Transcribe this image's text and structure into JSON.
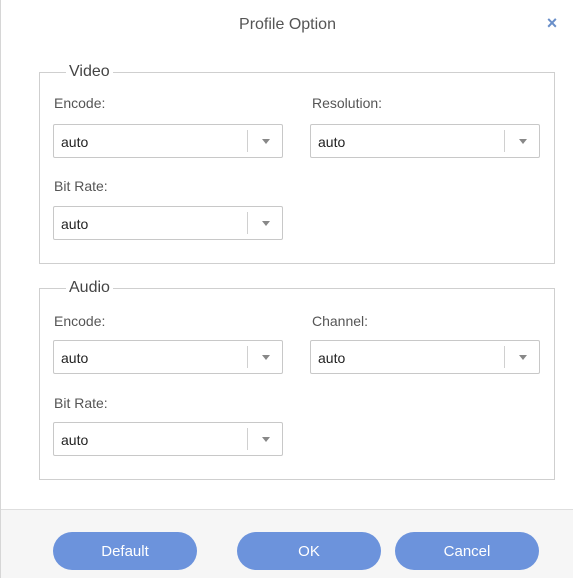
{
  "dialog": {
    "title": "Profile Option",
    "close_glyph": "×"
  },
  "video": {
    "legend": "Video",
    "encode_label": "Encode:",
    "encode_value": "auto",
    "resolution_label": "Resolution:",
    "resolution_value": "auto",
    "bitrate_label": "Bit Rate:",
    "bitrate_value": "auto"
  },
  "audio": {
    "legend": "Audio",
    "encode_label": "Encode:",
    "encode_value": "auto",
    "channel_label": "Channel:",
    "channel_value": "auto",
    "bitrate_label": "Bit Rate:",
    "bitrate_value": "auto"
  },
  "buttons": {
    "default_label": "Default",
    "ok_label": "OK",
    "cancel_label": "Cancel"
  },
  "colors": {
    "accent": "#6c93dc",
    "close_icon": "#6a8fc9"
  },
  "icons": {
    "close": "close-icon",
    "dropdown": "chevron-down-icon"
  }
}
